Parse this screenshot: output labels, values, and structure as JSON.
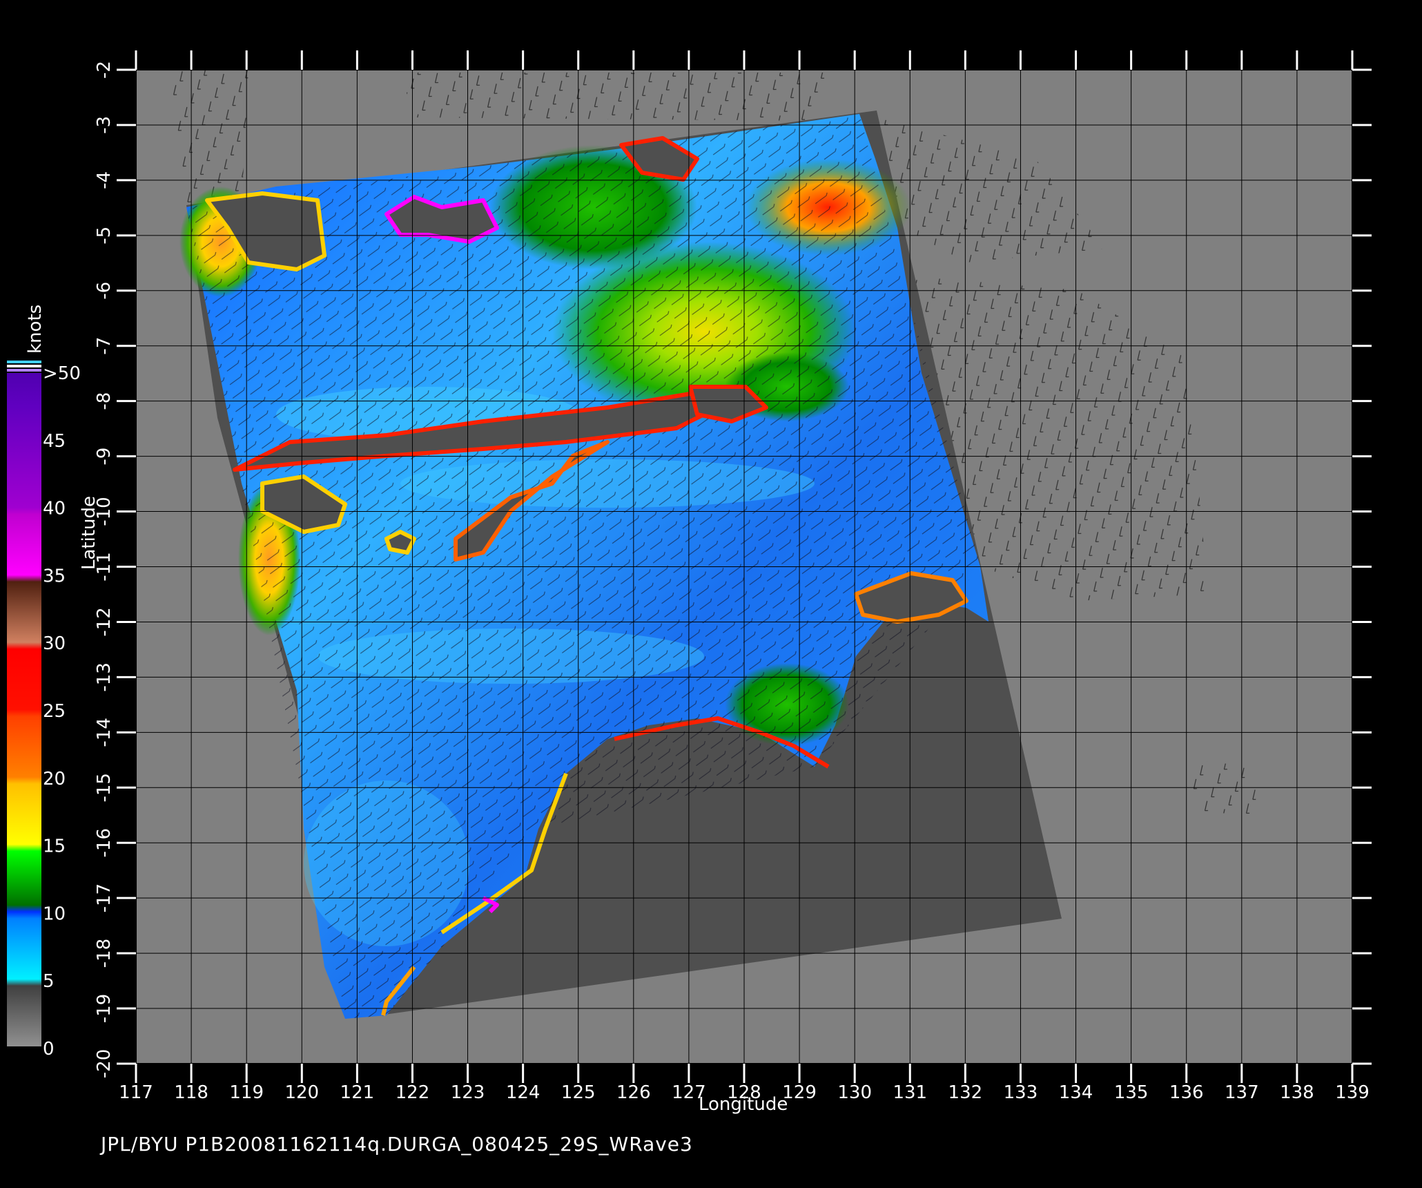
{
  "map": {
    "footer": "JPL/BYU  P1B20081162114q.DURGA_080425_29S_WRave3",
    "x_axis_title": "Longitude",
    "y_axis_title": "Latitude",
    "lon_ticks": [
      "117",
      "118",
      "119",
      "120",
      "121",
      "122",
      "123",
      "124",
      "125",
      "126",
      "127",
      "128",
      "129",
      "130",
      "131",
      "132",
      "133",
      "134",
      "135",
      "136",
      "137",
      "138",
      "139"
    ],
    "lat_ticks": [
      "-2",
      "-3",
      "-4",
      "-5",
      "-6",
      "-7",
      "-8",
      "-9",
      "-10",
      "-11",
      "-12",
      "-13",
      "-14",
      "-15",
      "-16",
      "-17",
      "-18",
      "-19",
      "-20"
    ],
    "lon_range": [
      117,
      139
    ],
    "lat_range": [
      -2,
      -20
    ]
  },
  "legend": {
    "units": "knots",
    "labels": [
      ">50",
      "45",
      "40",
      "35",
      "30",
      "25",
      "20",
      "15",
      "10",
      "5",
      "0"
    ],
    "colors": {
      "0_5": "#6f6f6f",
      "5_10": "#00d8ff",
      "10_15": "#0050ff",
      "15_20": "#00a000",
      "20_25": "#ffd000",
      "25_30": "#ff6000",
      "30_35": "#ff0000",
      "35_40": "#c07050",
      "40_45": "#e000e0",
      "45_50": "#8000c0"
    }
  }
}
